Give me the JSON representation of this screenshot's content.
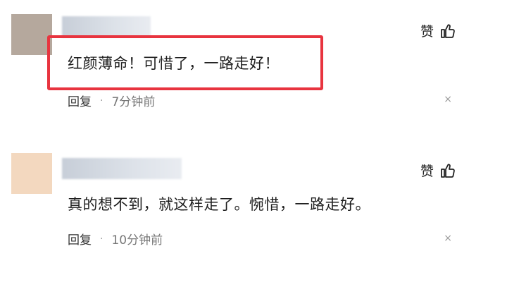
{
  "comments": [
    {
      "like_label": "赞",
      "text": "红颜薄命！可惜了，一路走好！",
      "reply_label": "回复",
      "separator": "·",
      "time": "7分钟前",
      "close": "×",
      "avatar_color": "#b5a89d"
    },
    {
      "like_label": "赞",
      "text": "真的想不到，就这样走了。惋惜，一路走好。",
      "reply_label": "回复",
      "separator": "·",
      "time": "10分钟前",
      "close": "×",
      "avatar_color": "#f3d8bf"
    }
  ],
  "colors": {
    "highlight_border": "#e8343f",
    "text": "#1e1e1e",
    "meta": "#777777"
  },
  "icons": {
    "like": "thumbs-up-icon",
    "close": "close-icon"
  }
}
